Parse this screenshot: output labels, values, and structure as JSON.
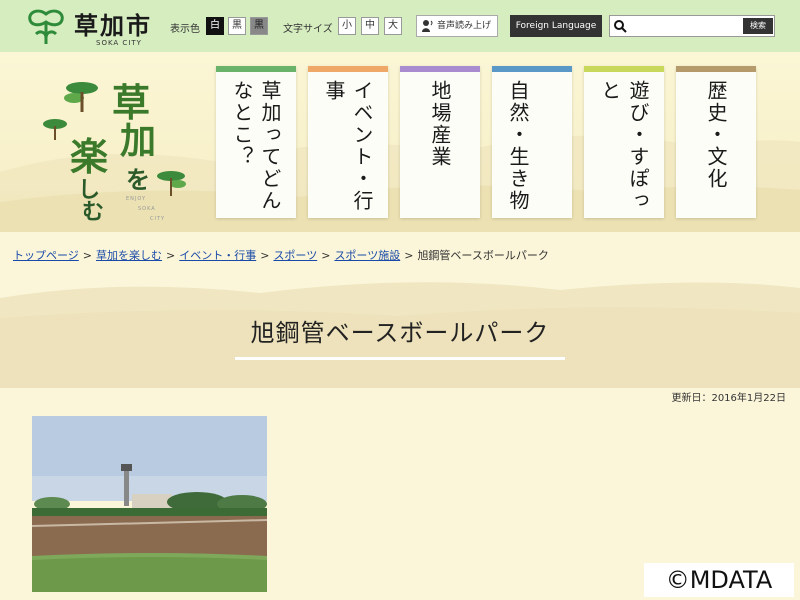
{
  "header": {
    "logo_text": "草加市",
    "logo_sub": "SOKA CITY",
    "color_label": "表示色",
    "color_options": [
      "白",
      "黒",
      "黒"
    ],
    "fontsize_label": "文字サイズ",
    "fontsize_options": [
      "小",
      "中",
      "大"
    ],
    "voice_label": "音声読み上げ",
    "language_label": "Foreign Language",
    "search_placeholder": "",
    "search_button": "検索"
  },
  "hero": {
    "title_chars": [
      "草",
      "加",
      "を",
      "楽",
      "し",
      "む"
    ],
    "enjoy_lines": [
      "ENJOY",
      "SOKA",
      "CITY"
    ],
    "cards": [
      {
        "label": "草加ってどんなとこ？",
        "color": "#6ab36a"
      },
      {
        "label": "イベント・行事",
        "color": "#f0a868"
      },
      {
        "label": "地場産業",
        "color": "#a98bd0"
      },
      {
        "label": "自然・生き物",
        "color": "#5a98c8"
      },
      {
        "label": "遊び・すぽっと",
        "color": "#c8d85a"
      },
      {
        "label": "歴史・文化",
        "color": "#b59b6b"
      }
    ]
  },
  "breadcrumb": {
    "items": [
      "トップページ",
      "草加を楽しむ",
      "イベント・行事",
      "スポーツ",
      "スポーツ施設"
    ],
    "current": "旭鋼管ベースボールパーク",
    "separator": ">"
  },
  "page": {
    "title": "旭鋼管ベースボールパーク",
    "updated": "更新日：2016年1月22日"
  },
  "copyright": "©MDATA"
}
